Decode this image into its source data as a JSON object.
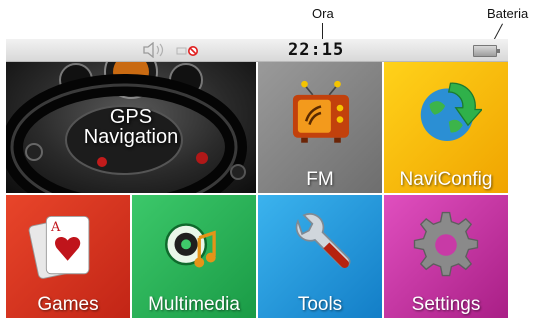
{
  "callouts": {
    "clock": "Ora",
    "battery": "Bateria"
  },
  "status_bar": {
    "time": "22:15",
    "icons": [
      "speaker-icon",
      "gps-status-icon",
      "battery-icon"
    ]
  },
  "tiles": {
    "gps": {
      "line1": "GPS",
      "line2": "Navigation",
      "icon": "steering-wheel-icon",
      "color": "#2a2a2a"
    },
    "fm": {
      "label": "FM",
      "icon": "radio-tv-icon",
      "color": "#8a8a8a"
    },
    "navi": {
      "label": "NaviConfig",
      "icon": "globe-arrow-icon",
      "color": "#f5b800"
    },
    "games": {
      "label": "Games",
      "icon": "playing-cards-icon",
      "color": "#d63420"
    },
    "multimedia": {
      "label": "Multimedia",
      "icon": "music-note-icon",
      "color": "#2ab556"
    },
    "tools": {
      "label": "Tools",
      "icon": "wrench-icon",
      "color": "#2799dd"
    },
    "settings": {
      "label": "Settings",
      "icon": "gear-icon",
      "color": "#c83aa6"
    }
  }
}
